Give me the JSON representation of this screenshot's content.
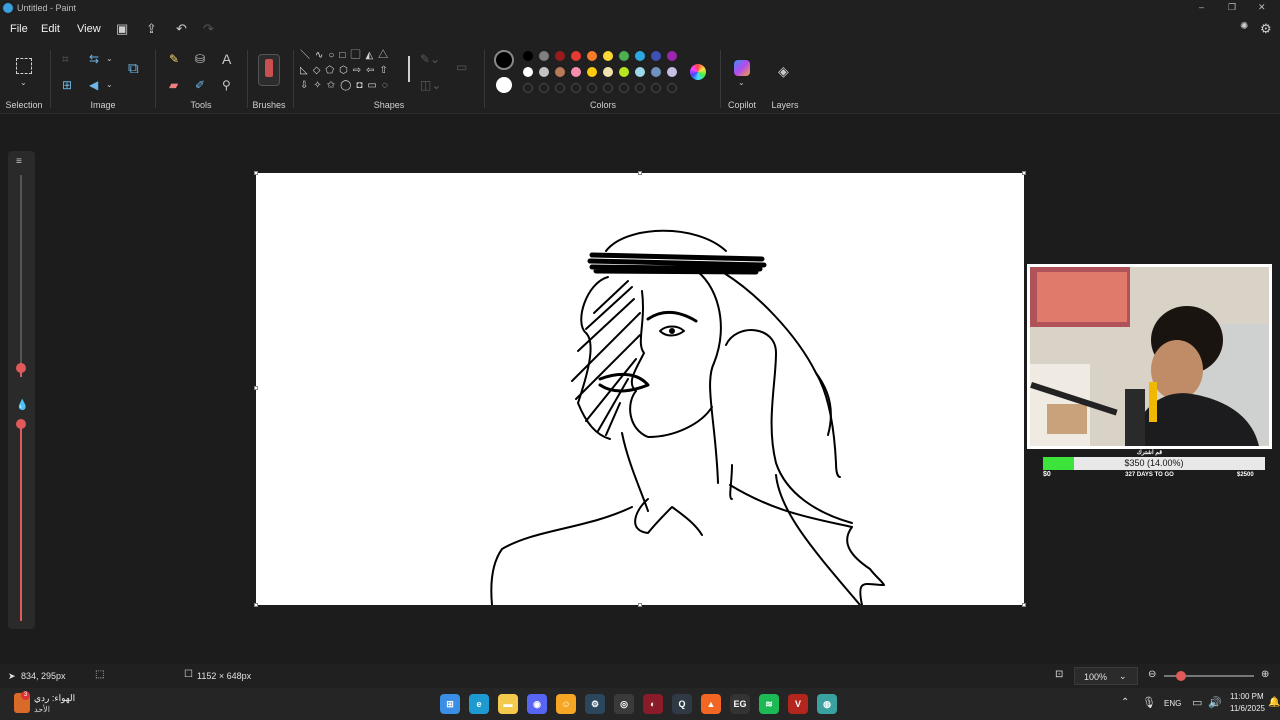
{
  "window": {
    "title": "Untitled - Paint",
    "controls": [
      "–",
      "❐",
      "✕"
    ]
  },
  "menu": {
    "items": [
      "File",
      "Edit",
      "View"
    ]
  },
  "ribbon": {
    "groups": {
      "selection": "Selection",
      "image": "Image",
      "tools": "Tools",
      "brushes": "Brushes",
      "shapes": "Shapes",
      "colors": "Colors",
      "copilot": "Copilot",
      "layers": "Layers"
    },
    "tools_text_glyph": "A",
    "primary_color": "#000000",
    "secondary_color": "#ffffff",
    "palette_row1": [
      "#000000",
      "#7f7f7f",
      "#9a1b1b",
      "#e53935",
      "#f57c28",
      "#fdd835",
      "#4caf50",
      "#2ca9e1",
      "#3f51b5",
      "#9c27b0"
    ],
    "palette_row2": [
      "#ffffff",
      "#c3c3c3",
      "#b97a57",
      "#f48fb1",
      "#ffc90e",
      "#efe4b0",
      "#b5e61d",
      "#99d9ea",
      "#7092be",
      "#c8bfe7"
    ]
  },
  "webcam_overlay": {
    "goal_title": "قم اشترك",
    "goal_text": "$350 (14.00%)",
    "goal_fraction": 0.14,
    "goal_start": "$0",
    "goal_end": "$2500",
    "days": "327 DAYS TO GO"
  },
  "status": {
    "cursor_pos": "834, 295px",
    "canvas_size": "1152 × 648px",
    "zoom": "100%"
  },
  "taskbar": {
    "weather_title": "الهواء: ردي",
    "weather_sub": "الأحد",
    "weather_badge": "3",
    "lang": "ENG",
    "time": "11:00 PM",
    "date": "11/6/2025",
    "apps": [
      {
        "name": "windows-start",
        "color": "#3a8ee6",
        "glyph": "⊞"
      },
      {
        "name": "edge",
        "color": "#1d9bd1",
        "glyph": "e"
      },
      {
        "name": "file-explorer",
        "color": "#f2c94c",
        "glyph": "▬"
      },
      {
        "name": "discord",
        "color": "#5865f2",
        "glyph": "◉"
      },
      {
        "name": "badge-app",
        "color": "#f5a623",
        "glyph": "☺"
      },
      {
        "name": "steam",
        "color": "#2a475e",
        "glyph": "⚙"
      },
      {
        "name": "obs",
        "color": "#3a3a3a",
        "glyph": "◎"
      },
      {
        "name": "paint",
        "color": "#8a1c2a",
        "glyph": "◐"
      },
      {
        "name": "camera",
        "color": "#303a46",
        "glyph": "Q"
      },
      {
        "name": "brave",
        "color": "#f26522",
        "glyph": "▲"
      },
      {
        "name": "epic-games",
        "color": "#333333",
        "glyph": "EG"
      },
      {
        "name": "spotify",
        "color": "#1db954",
        "glyph": "≋"
      },
      {
        "name": "voice-app",
        "color": "#b3261e",
        "glyph": "V"
      },
      {
        "name": "globe-app",
        "color": "#3aa0a0",
        "glyph": "◍"
      }
    ]
  }
}
